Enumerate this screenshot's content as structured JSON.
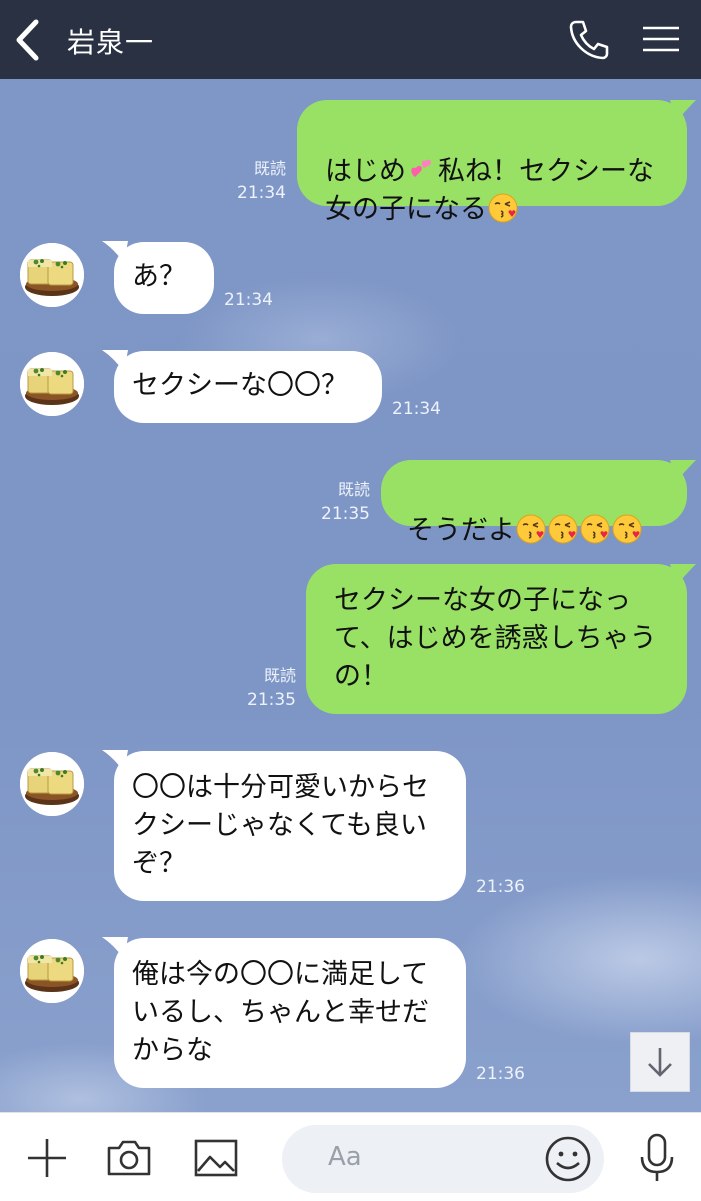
{
  "header": {
    "title": "岩泉一"
  },
  "messages": [
    {
      "line1": "はじめ",
      "line1b": "私ね！セクシーな",
      "line2": "女の子になる",
      "read": "既読",
      "time": "21:34"
    },
    {
      "text": "あ？",
      "time": "21:34"
    },
    {
      "text": "セクシーな〇〇？",
      "time": "21:34"
    },
    {
      "text": "そうだよ",
      "read": "既読",
      "time": "21:35"
    },
    {
      "text": "セクシーな女の子になっ\nて、はじめを誘惑しちゃう\nの！",
      "read": "既読",
      "time": "21:35"
    },
    {
      "text": "〇〇は十分可愛いからセ\nクシーじゃなくても良い\nぞ？",
      "time": "21:36"
    },
    {
      "text": "俺は今の〇〇に満足して\nいるし、ちゃんと幸せだ\nからな",
      "time": "21:36"
    }
  ],
  "input": {
    "placeholder": "Aa"
  },
  "icons": {
    "back": "chevron-left-icon",
    "phone": "phone-icon",
    "menu": "hamburger-menu-icon",
    "plus": "plus-icon",
    "camera": "camera-icon",
    "image": "image-icon",
    "emoji": "smiley-icon",
    "mic": "microphone-icon",
    "scroll": "arrow-down-icon",
    "heart": "two-hearts-icon",
    "kiss": "face-blowing-kiss-icon"
  },
  "colors": {
    "header": "#293142",
    "sent_bubble": "#98e165",
    "received_bubble": "#ffffff",
    "background": "#7e97c6"
  }
}
